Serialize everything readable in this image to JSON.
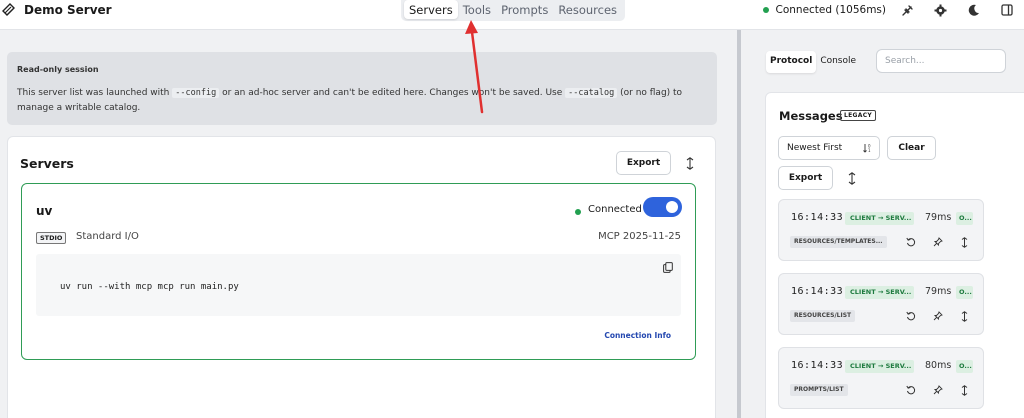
{
  "header": {
    "app_title": "Demo Server",
    "tabs": [
      "Servers",
      "Tools",
      "Prompts",
      "Resources"
    ],
    "connection_status": "Connected (1056ms)"
  },
  "read_only": {
    "title": "Read-only session",
    "text_1": "This server list was launched with",
    "code_1": "--config",
    "text_2": "or an ad-hoc server and can't be edited here. Changes won't be saved. Use",
    "code_2": "--catalog",
    "text_3": "(or no flag) to manage a writable catalog."
  },
  "servers": {
    "title": "Servers",
    "export_label": "Export",
    "card": {
      "name": "uv",
      "status": "Connected",
      "transport_badge": "STDIO",
      "transport": "Standard I/O",
      "protocol": "MCP 2025-11-25",
      "command": "uv run --with mcp mcp run main.py",
      "connection_info": "Connection Info"
    }
  },
  "right_panel": {
    "tabs": [
      "Protocol",
      "Console"
    ],
    "search_placeholder": "Search...",
    "messages_title": "Messages",
    "legacy_badge": "LEGACY",
    "order": "Newest First",
    "clear_label": "Clear",
    "export_label": "Export",
    "messages": [
      {
        "time": "16:14:33",
        "direction": "CLIENT → SERV...",
        "duration": "79ms",
        "status": "O...",
        "method": "RESOURCES/TEMPLATES..."
      },
      {
        "time": "16:14:33",
        "direction": "CLIENT → SERV...",
        "duration": "79ms",
        "status": "O...",
        "method": "RESOURCES/LIST"
      },
      {
        "time": "16:14:33",
        "direction": "CLIENT → SERV...",
        "duration": "80ms",
        "status": "O...",
        "method": "PROMPTS/LIST"
      }
    ]
  },
  "colors": {
    "accent_blue": "#2e63dc",
    "connected_green": "#22a050",
    "annotation_red": "#e03030"
  }
}
